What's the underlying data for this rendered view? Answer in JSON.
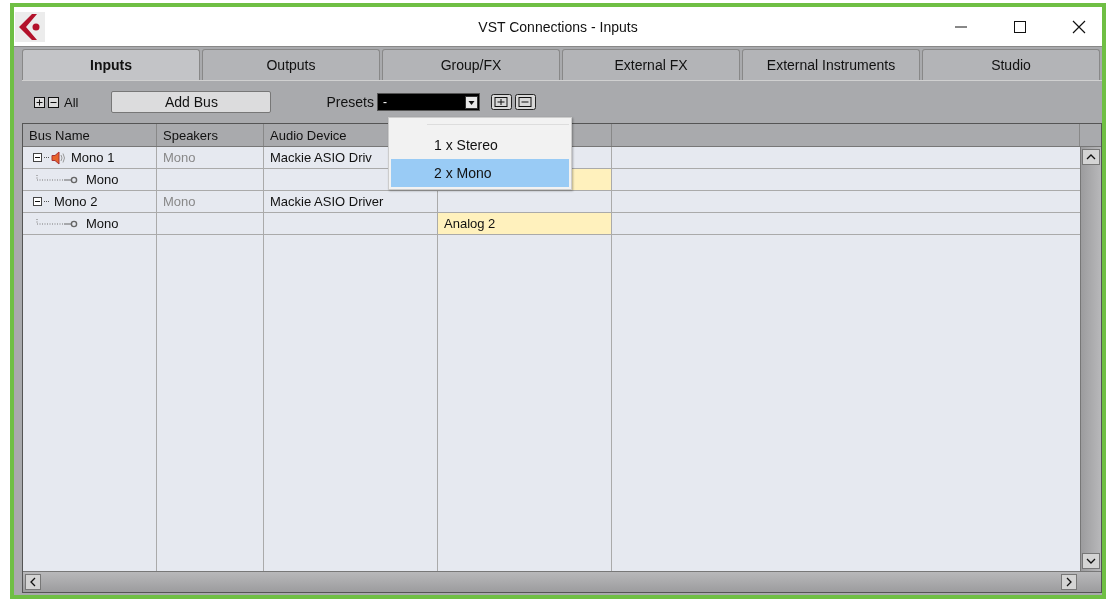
{
  "window": {
    "title": "VST Connections - Inputs"
  },
  "tabs": [
    {
      "label": "Inputs",
      "selected": true
    },
    {
      "label": "Outputs",
      "selected": false
    },
    {
      "label": "Group/FX",
      "selected": false
    },
    {
      "label": "External FX",
      "selected": false
    },
    {
      "label": "External Instruments",
      "selected": false
    },
    {
      "label": "Studio",
      "selected": false
    }
  ],
  "toolbar": {
    "all_label": "All",
    "add_bus_button": "Add Bus",
    "presets_label": "Presets",
    "presets_value": "-"
  },
  "table": {
    "columns": [
      "Bus Name",
      "Speakers",
      "Audio Device"
    ],
    "buses": [
      {
        "name": "Mono 1",
        "speakers": "Mono",
        "audio_device": "Mackie ASIO Driv",
        "expanded": true,
        "monitored": true,
        "port_highlighted": false,
        "children": [
          {
            "name": "Mono",
            "port_highlighted": true
          }
        ]
      },
      {
        "name": "Mono 2",
        "speakers": "Mono",
        "audio_device": "Mackie ASIO Driver",
        "expanded": true,
        "monitored": false,
        "port_highlighted": false,
        "children": [
          {
            "name": "Mono",
            "port": "Analog 2",
            "port_highlighted": true
          }
        ]
      }
    ]
  },
  "presets_menu": [
    {
      "label": "1 x Stereo",
      "selected": false
    },
    {
      "label": "2 x Mono",
      "selected": true
    }
  ]
}
